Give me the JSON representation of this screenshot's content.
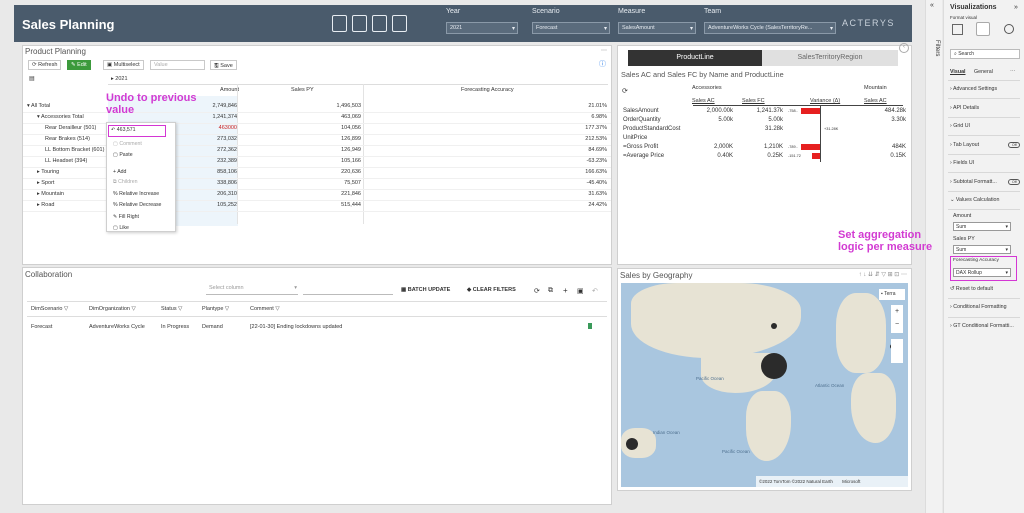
{
  "header": {
    "title": "Sales Planning",
    "logo": "ACTERYS",
    "year_label": "Year",
    "year_value": "2021",
    "scenario_label": "Scenario",
    "scenario_value": "Forecast",
    "measure_label": "Measure",
    "measure_value": "SalesAmount",
    "team_label": "Team",
    "team_value": "AdventureWorks Cycle (SalesTerritoryRe..."
  },
  "planning": {
    "title": "Product Planning",
    "refresh": "Refresh",
    "edit": "Edit",
    "multiselect": "Multiselect",
    "value_placeholder": "Value",
    "save": "Save",
    "year": "2021",
    "columns": [
      "Amount",
      "Sales PY",
      "Forecasting Accuracy"
    ],
    "rows": [
      {
        "label": "All Total",
        "amount": "2,749,846",
        "py": "1,496,503",
        "acc": "21.01%"
      },
      {
        "label": "Accessories Total",
        "amount": "1,241,374",
        "py": "463,069",
        "acc": "6.98%"
      },
      {
        "label": "Rear Derailleur (501)",
        "amount": "",
        "py": "104,056",
        "acc": "177.37%"
      },
      {
        "label": "Rear Brakes (514)",
        "amount": "273,032",
        "py": "126,899",
        "acc": "212.53%"
      },
      {
        "label": "LL Bottom Bracket (601)",
        "amount": "272,362",
        "py": "126,949",
        "acc": "84.69%"
      },
      {
        "label": "LL Headset (394)",
        "amount": "232,389",
        "py": "105,166",
        "acc": "-63.23%"
      },
      {
        "label": "Touring",
        "amount": "858,106",
        "py": "220,636",
        "acc": "166.63%"
      },
      {
        "label": "Sport",
        "amount": "338,806",
        "py": "75,507",
        "acc": "-45.40%"
      },
      {
        "label": "Mountain",
        "amount": "206,310",
        "py": "221,846",
        "acc": "31.63%"
      },
      {
        "label": "Road",
        "amount": "105,252",
        "py": "515,444",
        "acc": "24.42%"
      }
    ],
    "edited_value": "463000"
  },
  "context_menu": {
    "undo_value": "463,571",
    "items": [
      "Comment",
      "Paste",
      "Add",
      "Children",
      "Relative Increase",
      "Relative Decrease",
      "Fill Right",
      "Like"
    ]
  },
  "annotations": {
    "undo": "Undo to previous value",
    "aggregation": "Set aggregation logic per measure"
  },
  "collab": {
    "title": "Collaboration",
    "select_column": "Select column",
    "batch": "BATCH UPDATE",
    "clear": "CLEAR FILTERS",
    "columns": [
      "DimScenario",
      "DimOrganization",
      "Status",
      "Plantype",
      "Comment"
    ],
    "row": [
      "Forecast",
      "AdventureWorks Cycle",
      "In Progress",
      "Demand",
      "[22-01-30] Ending lockdowns updated"
    ]
  },
  "zebra": {
    "tab1": "ProductLine",
    "tab2": "SalesTerritoryRegion",
    "title": "Sales AC and Sales FC by Name and ProductLine",
    "group1": "Accessories",
    "group2": "Mountain",
    "cols": [
      "Sales AC",
      "Sales FC",
      "Variance (Δ)",
      "Sales AC"
    ],
    "rows": [
      {
        "name": "SalesAmount",
        "ac": "2,000.00k",
        "fc": "1,241.37k",
        "var": "-758..",
        "m": "484.28k"
      },
      {
        "name": "OrderQuantity",
        "ac": "5.00k",
        "fc": "5.00k",
        "var": "",
        "m": "3.30k"
      },
      {
        "name": "ProductStandardCost",
        "ac": "",
        "fc": "31.28k",
        "var": "+31.28K",
        "m": ""
      },
      {
        "name": "UnitPrice",
        "ac": "",
        "fc": "",
        "var": "",
        "m": ""
      },
      {
        "name": "=Gross Profit",
        "ac": "2,000K",
        "fc": "1,210K",
        "var": "-789..",
        "m": "484K"
      },
      {
        "name": "=Average Price",
        "ac": "0.40K",
        "fc": "0.25K",
        "var": "-151.72",
        "m": "0.15K"
      }
    ]
  },
  "geo": {
    "title": "Sales by Geography",
    "terrain": "Terra",
    "pacific1": "Pacific Ocean",
    "atlantic": "Atlantic Ocean",
    "indian": "Indian Ocean",
    "pacific2": "Pacific Ocean",
    "copyright": "©2022 TomTom ©2022 Natural Earth",
    "ms": "Microsoft"
  },
  "viz": {
    "title": "Visualizations",
    "format": "Format visual",
    "filters": "Filters",
    "search": "Search",
    "tab_visual": "Visual",
    "tab_general": "General",
    "sections": [
      "Advanced Settings",
      "API Details",
      "Grid UI",
      "Tab Layout",
      "Fields UI",
      "Subtotal Formatt...",
      "Values Calculation"
    ],
    "amount_label": "Amount",
    "amount_val": "Sum",
    "py_label": "Sales PY",
    "py_val": "Sum",
    "fa_label": "Forecasting Accuracy",
    "fa_val": "DAX Rollup",
    "reset": "Reset to default",
    "cond": "Conditional Formatting",
    "gt": "GT Conditional Formatti..."
  }
}
